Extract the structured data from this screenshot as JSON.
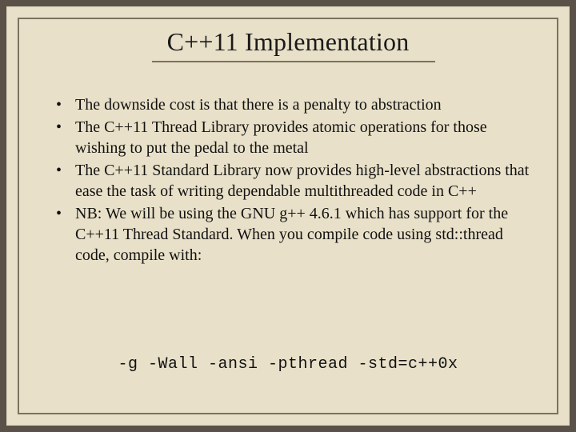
{
  "slide": {
    "title": "C++11 Implementation",
    "bullets": [
      "The downside cost is that there is a penalty to abstraction",
      "The C++11 Thread Library provides atomic operations for those wishing to put the pedal to the metal",
      "The C++11 Standard Library now provides high-level abstractions that ease the task of writing dependable multithreaded code in C++",
      "NB:  We will be using the GNU g++ 4.6.1 which has support for the C++11 Thread Standard.  When you compile code using std::thread code, compile with:"
    ],
    "code": "-g -Wall -ansi -pthread -std=c++0x"
  }
}
